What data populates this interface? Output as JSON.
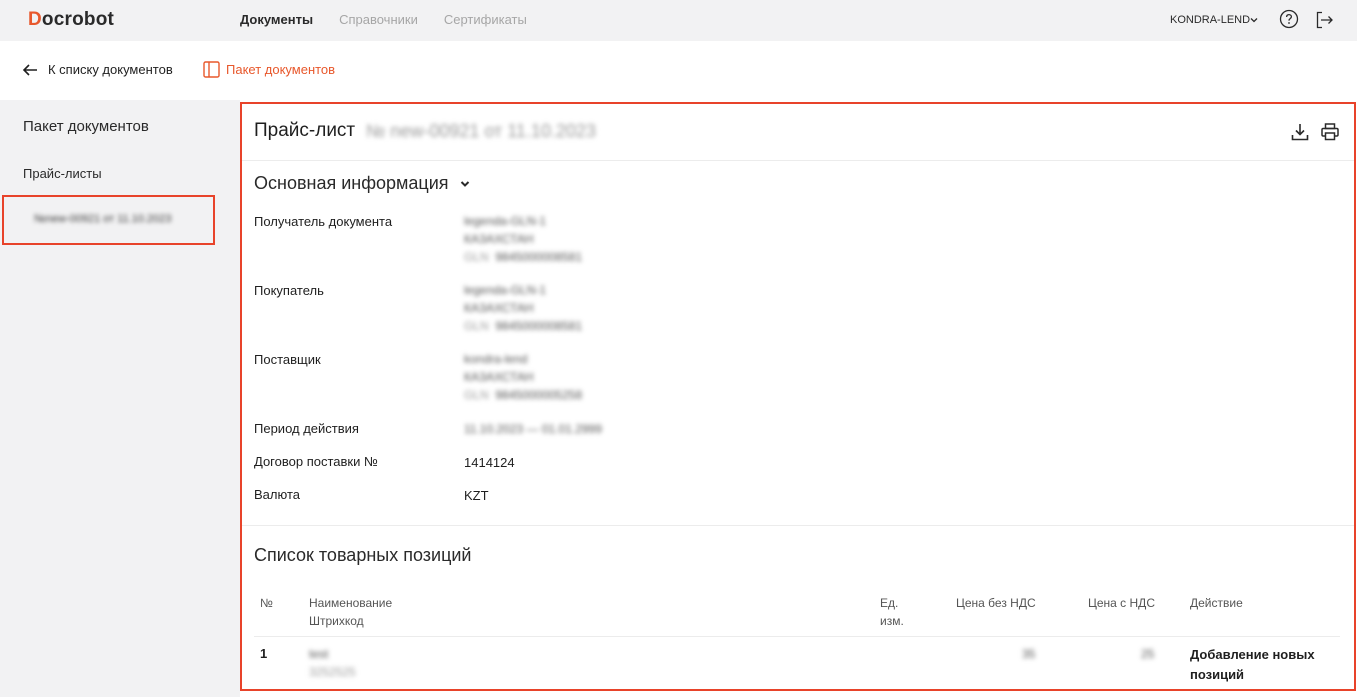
{
  "app": {
    "logo": "Docrobot",
    "nav": [
      "Документы",
      "Справочники",
      "Сертификаты"
    ],
    "user": "KONDRA-LEND"
  },
  "subheader": {
    "back": "К списку документов",
    "pack": "Пакет документов"
  },
  "sidebar": {
    "title": "Пакет документов",
    "group": "Прайс-листы",
    "item": "№new-00921 от 11.10.2023"
  },
  "document": {
    "title": "Прайс-лист",
    "number": "№ new-00921 от 11.10.2023",
    "section_main": "Основная информация",
    "fields": {
      "recipient": {
        "label": "Получатель документа",
        "name": "legenda-GLN-1",
        "country": "КАЗАХСТАН",
        "gln_label": "GLN",
        "gln": "9845000008581"
      },
      "buyer": {
        "label": "Покупатель",
        "name": "legenda-GLN-1",
        "country": "КАЗАХСТАН",
        "gln_label": "GLN",
        "gln": "9845000008581"
      },
      "supplier": {
        "label": "Поставщик",
        "name": "kondra-lend",
        "country": "КАЗАХСТАН",
        "gln_label": "GLN",
        "gln": "9845000005258"
      },
      "period": {
        "label": "Период действия",
        "value": "11.10.2023 — 01.01.2999"
      },
      "contract": {
        "label": "Договор поставки №",
        "value": "1414124"
      },
      "currency": {
        "label": "Валюта",
        "value": "KZT"
      }
    },
    "section_list": "Список товарных позиций",
    "table": {
      "headers": {
        "num": "№",
        "name": "Наименование",
        "barcode": "Штрихкод",
        "unit1": "Ед.",
        "unit2": "изм.",
        "price_no_vat": "Цена без НДС",
        "price_vat": "Цена с НДС",
        "action": "Действие"
      },
      "rows": [
        {
          "num": "1",
          "name": "test",
          "barcode": "3252525",
          "price_no_vat": "35",
          "price_vat": "25",
          "action1": "Добавление новых",
          "action2": "позиций"
        }
      ]
    }
  }
}
